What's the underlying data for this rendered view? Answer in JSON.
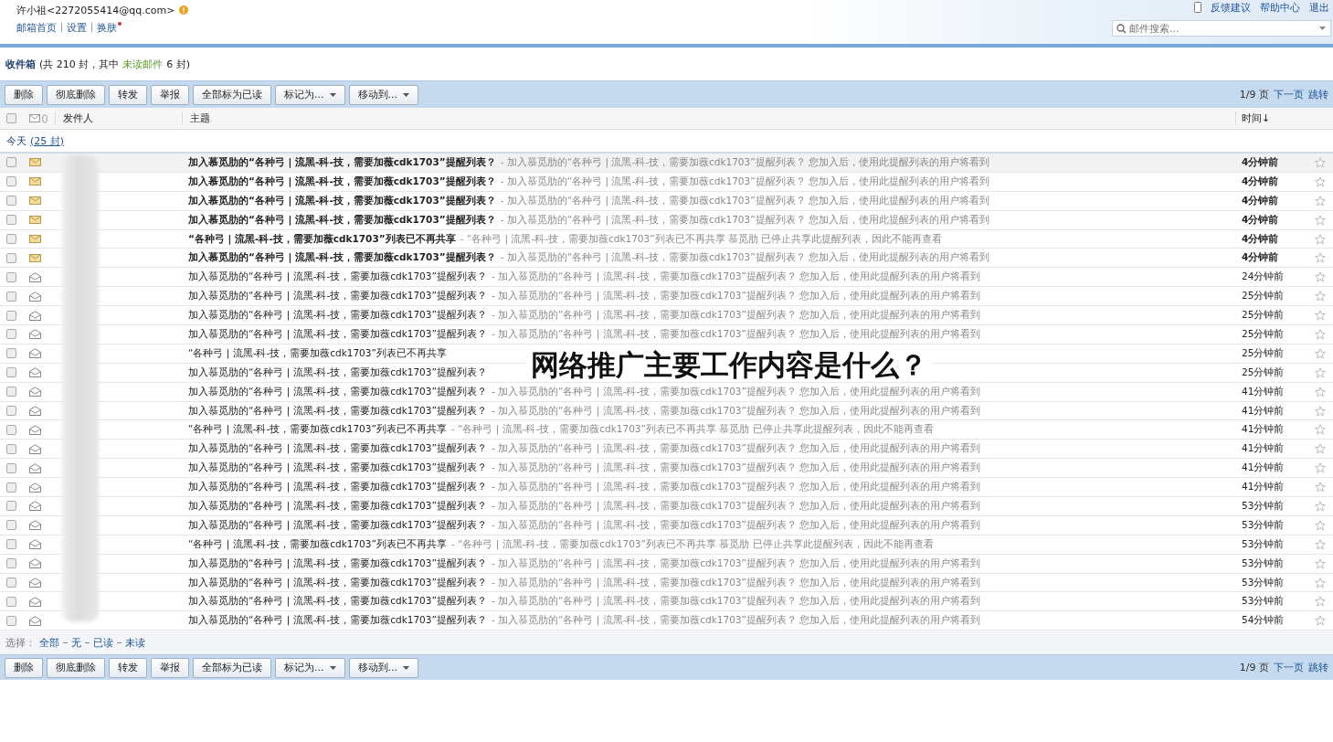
{
  "header": {
    "user": "许小祖<2272055414@qq.com>",
    "links": [
      "邮箱首页",
      "设置",
      "换肤"
    ],
    "top_links": [
      "反馈建议",
      "帮助中心",
      "退出"
    ],
    "search": {
      "placeholder": "邮件搜索..."
    }
  },
  "folder": {
    "title": "收件箱",
    "summary_start": "(共 210 封，其中",
    "unread_link": "未读邮件",
    "summary_end": "6 封)"
  },
  "toolbars": [
    {
      "buttons": [
        {
          "label": "删除",
          "kind": "plain"
        },
        {
          "label": "彻底删除",
          "kind": "plain"
        },
        {
          "label": "转发",
          "kind": "plain"
        },
        {
          "label": "举报",
          "kind": "plain"
        },
        {
          "label": "全部标为已读",
          "kind": "plain"
        },
        {
          "label": "标记为...",
          "kind": "menu"
        },
        {
          "label": "移动到...",
          "kind": "menu"
        }
      ],
      "page": "1/9 页",
      "next": "下一页",
      "jump": "跳转"
    },
    {
      "buttons": [
        {
          "label": "删除",
          "kind": "plain"
        },
        {
          "label": "彻底删除",
          "kind": "plain"
        },
        {
          "label": "转发",
          "kind": "plain"
        },
        {
          "label": "举报",
          "kind": "plain"
        },
        {
          "label": "全部标为已读",
          "kind": "plain"
        },
        {
          "label": "标记为...",
          "kind": "menu"
        },
        {
          "label": "移动到...",
          "kind": "menu"
        }
      ],
      "page": "1/9 页",
      "next": "下一页",
      "jump": "跳转"
    }
  ],
  "columns": {
    "select_all_checked": false,
    "sender": "发件人",
    "subject": "主题",
    "time": "时间↓"
  },
  "group": {
    "label": "今天",
    "count": "(25 封)"
  },
  "rows": [
    {
      "checked": false,
      "unread": true,
      "subject": "加入慕觅肋的“各种弓 | 流黑-科-技，需要加薇cdk1703”提醒列表？",
      "preview": "- 加入慕觅肋的“各种弓 | 流黑-科-技，需要加薇cdk1703”提醒列表？ 您加入后，使用此提醒列表的用户将看到",
      "time": "4分钟前"
    },
    {
      "checked": false,
      "unread": true,
      "subject": "加入慕觅肋的“各种弓 | 流黑-科-技，需要加薇cdk1703”提醒列表？",
      "preview": "- 加入慕觅肋的“各种弓 | 流黑-科-技，需要加薇cdk1703”提醒列表？ 您加入后，使用此提醒列表的用户将看到",
      "time": "4分钟前"
    },
    {
      "checked": false,
      "unread": true,
      "subject": "加入慕觅肋的“各种弓 | 流黑-科-技，需要加薇cdk1703”提醒列表？",
      "preview": "- 加入慕觅肋的“各种弓 | 流黑-科-技，需要加薇cdk1703”提醒列表？ 您加入后，使用此提醒列表的用户将看到",
      "time": "4分钟前"
    },
    {
      "checked": false,
      "unread": true,
      "subject": "加入慕觅肋的“各种弓 | 流黑-科-技，需要加薇cdk1703”提醒列表？",
      "preview": "- 加入慕觅肋的“各种弓 | 流黑-科-技，需要加薇cdk1703”提醒列表？ 您加入后，使用此提醒列表的用户将看到",
      "time": "4分钟前"
    },
    {
      "checked": false,
      "unread": true,
      "subject": "“各种弓 | 流黑-科-技，需要加薇cdk1703”列表已不再共享",
      "preview": "- “各种弓 | 流黑-科-技，需要加薇cdk1703”列表已不再共享 慕觅肋 已停止共享此提醒列表，因此不能再查看",
      "time": "4分钟前"
    },
    {
      "checked": false,
      "unread": true,
      "subject": "加入慕觅肋的“各种弓 | 流黑-科-技，需要加薇cdk1703”提醒列表？",
      "preview": "- 加入慕觅肋的“各种弓 | 流黑-科-技，需要加薇cdk1703”提醒列表？ 您加入后，使用此提醒列表的用户将看到",
      "time": "4分钟前"
    },
    {
      "checked": false,
      "unread": false,
      "subject": "加入慕觅肋的“各种弓 | 流黑-科-技，需要加薇cdk1703”提醒列表？",
      "preview": "- 加入慕觅肋的“各种弓 | 流黑-科-技，需要加薇cdk1703”提醒列表？ 您加入后，使用此提醒列表的用户将看到",
      "time": "24分钟前"
    },
    {
      "checked": false,
      "unread": false,
      "subject": "加入慕觅肋的“各种弓 | 流黑-科-技，需要加薇cdk1703”提醒列表？",
      "preview": "- 加入慕觅肋的“各种弓 | 流黑-科-技，需要加薇cdk1703”提醒列表？ 您加入后，使用此提醒列表的用户将看到",
      "time": "25分钟前"
    },
    {
      "checked": false,
      "unread": false,
      "subject": "加入慕觅肋的“各种弓 | 流黑-科-技，需要加薇cdk1703”提醒列表？",
      "preview": "- 加入慕觅肋的“各种弓 | 流黑-科-技，需要加薇cdk1703”提醒列表？ 您加入后，使用此提醒列表的用户将看到",
      "time": "25分钟前"
    },
    {
      "checked": false,
      "unread": false,
      "subject": "加入慕觅肋的“各种弓 | 流黑-科-技，需要加薇cdk1703”提醒列表？",
      "preview": "- 加入慕觅肋的“各种弓 | 流黑-科-技，需要加薇cdk1703”提醒列表？ 您加入后，使用此提醒列表的用户将看到",
      "time": "25分钟前"
    },
    {
      "checked": false,
      "unread": false,
      "subject": "“各种弓 | 流黑-科-技，需要加薇cdk1703”列表已不再共享",
      "time": "25分钟前"
    },
    {
      "checked": false,
      "unread": false,
      "subject": "加入慕觅肋的“各种弓 | 流黑-科-技，需要加薇cdk1703”提醒列表？",
      "time": "25分钟前"
    },
    {
      "checked": false,
      "unread": false,
      "subject": "加入慕觅肋的“各种弓 | 流黑-科-技，需要加薇cdk1703”提醒列表？",
      "preview": "- 加入慕觅肋的“各种弓 | 流黑-科-技，需要加薇cdk1703”提醒列表？ 您加入后，使用此提醒列表的用户将看到",
      "time": "41分钟前"
    },
    {
      "checked": false,
      "unread": false,
      "subject": "加入慕觅肋的“各种弓 | 流黑-科-技，需要加薇cdk1703”提醒列表？",
      "preview": "- 加入慕觅肋的“各种弓 | 流黑-科-技，需要加薇cdk1703”提醒列表？ 您加入后，使用此提醒列表的用户将看到",
      "time": "41分钟前"
    },
    {
      "checked": false,
      "unread": false,
      "subject": "“各种弓 | 流黑-科-技，需要加薇cdk1703”列表已不再共享",
      "preview": "- “各种弓 | 流黑-科-技，需要加薇cdk1703”列表已不再共享 慕觅肋 已停止共享此提醒列表，因此不能再查看",
      "time": "41分钟前"
    },
    {
      "checked": false,
      "unread": false,
      "subject": "加入慕觅肋的“各种弓 | 流黑-科-技，需要加薇cdk1703”提醒列表？",
      "preview": "- 加入慕觅肋的“各种弓 | 流黑-科-技，需要加薇cdk1703”提醒列表？ 您加入后，使用此提醒列表的用户将看到",
      "time": "41分钟前"
    },
    {
      "checked": false,
      "unread": false,
      "subject": "加入慕觅肋的“各种弓 | 流黑-科-技，需要加薇cdk1703”提醒列表？",
      "preview": "- 加入慕觅肋的“各种弓 | 流黑-科-技，需要加薇cdk1703”提醒列表？ 您加入后，使用此提醒列表的用户将看到",
      "time": "41分钟前"
    },
    {
      "checked": false,
      "unread": false,
      "subject": "加入慕觅肋的“各种弓 | 流黑-科-技，需要加薇cdk1703”提醒列表？",
      "preview": "- 加入慕觅肋的“各种弓 | 流黑-科-技，需要加薇cdk1703”提醒列表？ 您加入后，使用此提醒列表的用户将看到",
      "time": "41分钟前"
    },
    {
      "checked": false,
      "unread": false,
      "subject": "加入慕觅肋的“各种弓 | 流黑-科-技，需要加薇cdk1703”提醒列表？",
      "preview": "- 加入慕觅肋的“各种弓 | 流黑-科-技，需要加薇cdk1703”提醒列表？ 您加入后，使用此提醒列表的用户将看到",
      "time": "53分钟前"
    },
    {
      "checked": false,
      "unread": false,
      "subject": "加入慕觅肋的“各种弓 | 流黑-科-技，需要加薇cdk1703”提醒列表？",
      "preview": "- 加入慕觅肋的“各种弓 | 流黑-科-技，需要加薇cdk1703”提醒列表？ 您加入后，使用此提醒列表的用户将看到",
      "time": "53分钟前"
    },
    {
      "checked": false,
      "unread": false,
      "subject": "“各种弓 | 流黑-科-技，需要加薇cdk1703”列表已不再共享",
      "preview": "- “各种弓 | 流黑-科-技，需要加薇cdk1703”列表已不再共享 慕觅肋 已停止共享此提醒列表，因此不能再查看",
      "time": "53分钟前"
    },
    {
      "checked": false,
      "unread": false,
      "subject": "加入慕觅肋的“各种弓 | 流黑-科-技，需要加薇cdk1703”提醒列表？",
      "preview": "- 加入慕觅肋的“各种弓 | 流黑-科-技，需要加薇cdk1703”提醒列表？ 您加入后，使用此提醒列表的用户将看到",
      "time": "53分钟前"
    },
    {
      "checked": false,
      "unread": false,
      "subject": "加入慕觅肋的“各种弓 | 流黑-科-技，需要加薇cdk1703”提醒列表？",
      "preview": "- 加入慕觅肋的“各种弓 | 流黑-科-技，需要加薇cdk1703”提醒列表？ 您加入后，使用此提醒列表的用户将看到",
      "time": "53分钟前"
    },
    {
      "checked": false,
      "unread": false,
      "subject": "加入慕觅肋的“各种弓 | 流黑-科-技，需要加薇cdk1703”提醒列表？",
      "preview": "- 加入慕觅肋的“各种弓 | 流黑-科-技，需要加薇cdk1703”提醒列表？ 您加入后，使用此提醒列表的用户将看到",
      "time": "53分钟前"
    },
    {
      "checked": false,
      "unread": false,
      "subject": "加入慕觅肋的“各种弓 | 流黑-科-技，需要加薇cdk1703”提醒列表？",
      "preview": "- 加入慕觅肋的“各种弓 | 流黑-科-技，需要加薇cdk1703”提醒列表？ 您加入后，使用此提醒列表的用户将看到",
      "time": "54分钟前"
    }
  ],
  "select": {
    "label": "选择：",
    "options": [
      "全部",
      "无",
      "已读",
      "未读"
    ]
  },
  "overlay_title": "网络推广主要工作内容是什么？"
}
